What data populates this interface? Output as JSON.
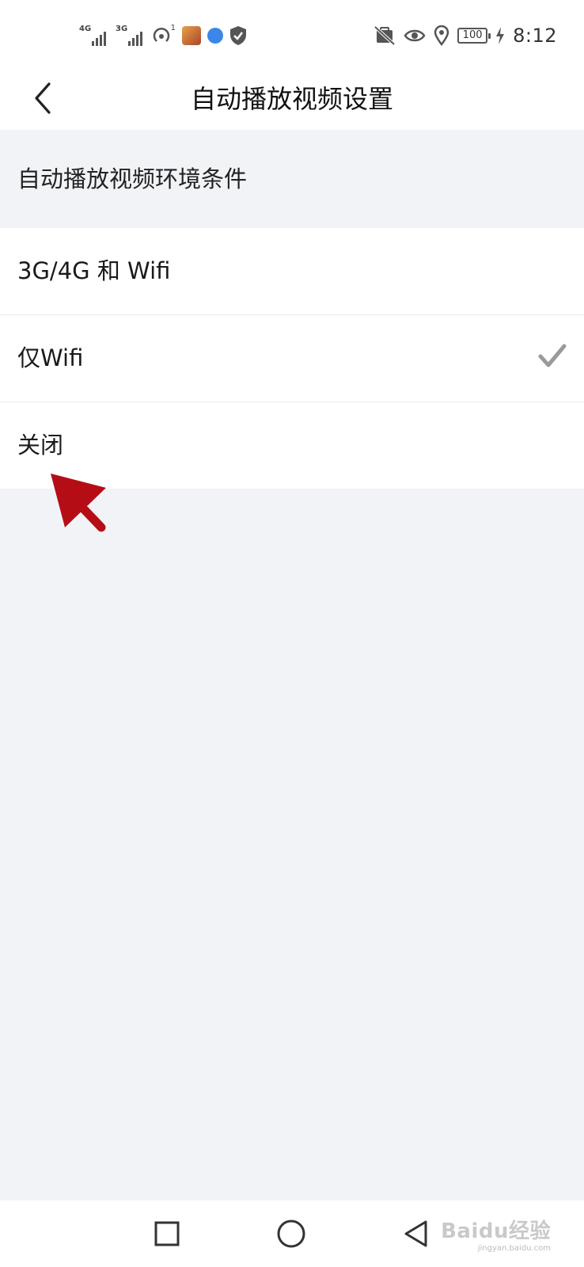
{
  "status_bar": {
    "network_1": "4G",
    "network_2": "3G",
    "hotspot_badge": "1",
    "battery": "100",
    "time": "8:12"
  },
  "header": {
    "title": "自动播放视频设置"
  },
  "section": {
    "title": "自动播放视频环境条件"
  },
  "options": [
    {
      "label": "3G/4G 和 Wifi",
      "selected": false
    },
    {
      "label": "仅Wifi",
      "selected": true
    },
    {
      "label": "关闭",
      "selected": false
    }
  ],
  "annotation": {
    "color": "#b50d16"
  },
  "bottom_nav": {
    "recents_icon": "square-icon",
    "home_icon": "circle-icon",
    "back_icon": "triangle-back-icon"
  },
  "watermark": {
    "text": "Baidu经验",
    "url": "jingyan.baidu.com"
  },
  "colors": {
    "background": "#f2f3f7",
    "surface": "#ffffff",
    "check": "#9a9a9a"
  }
}
